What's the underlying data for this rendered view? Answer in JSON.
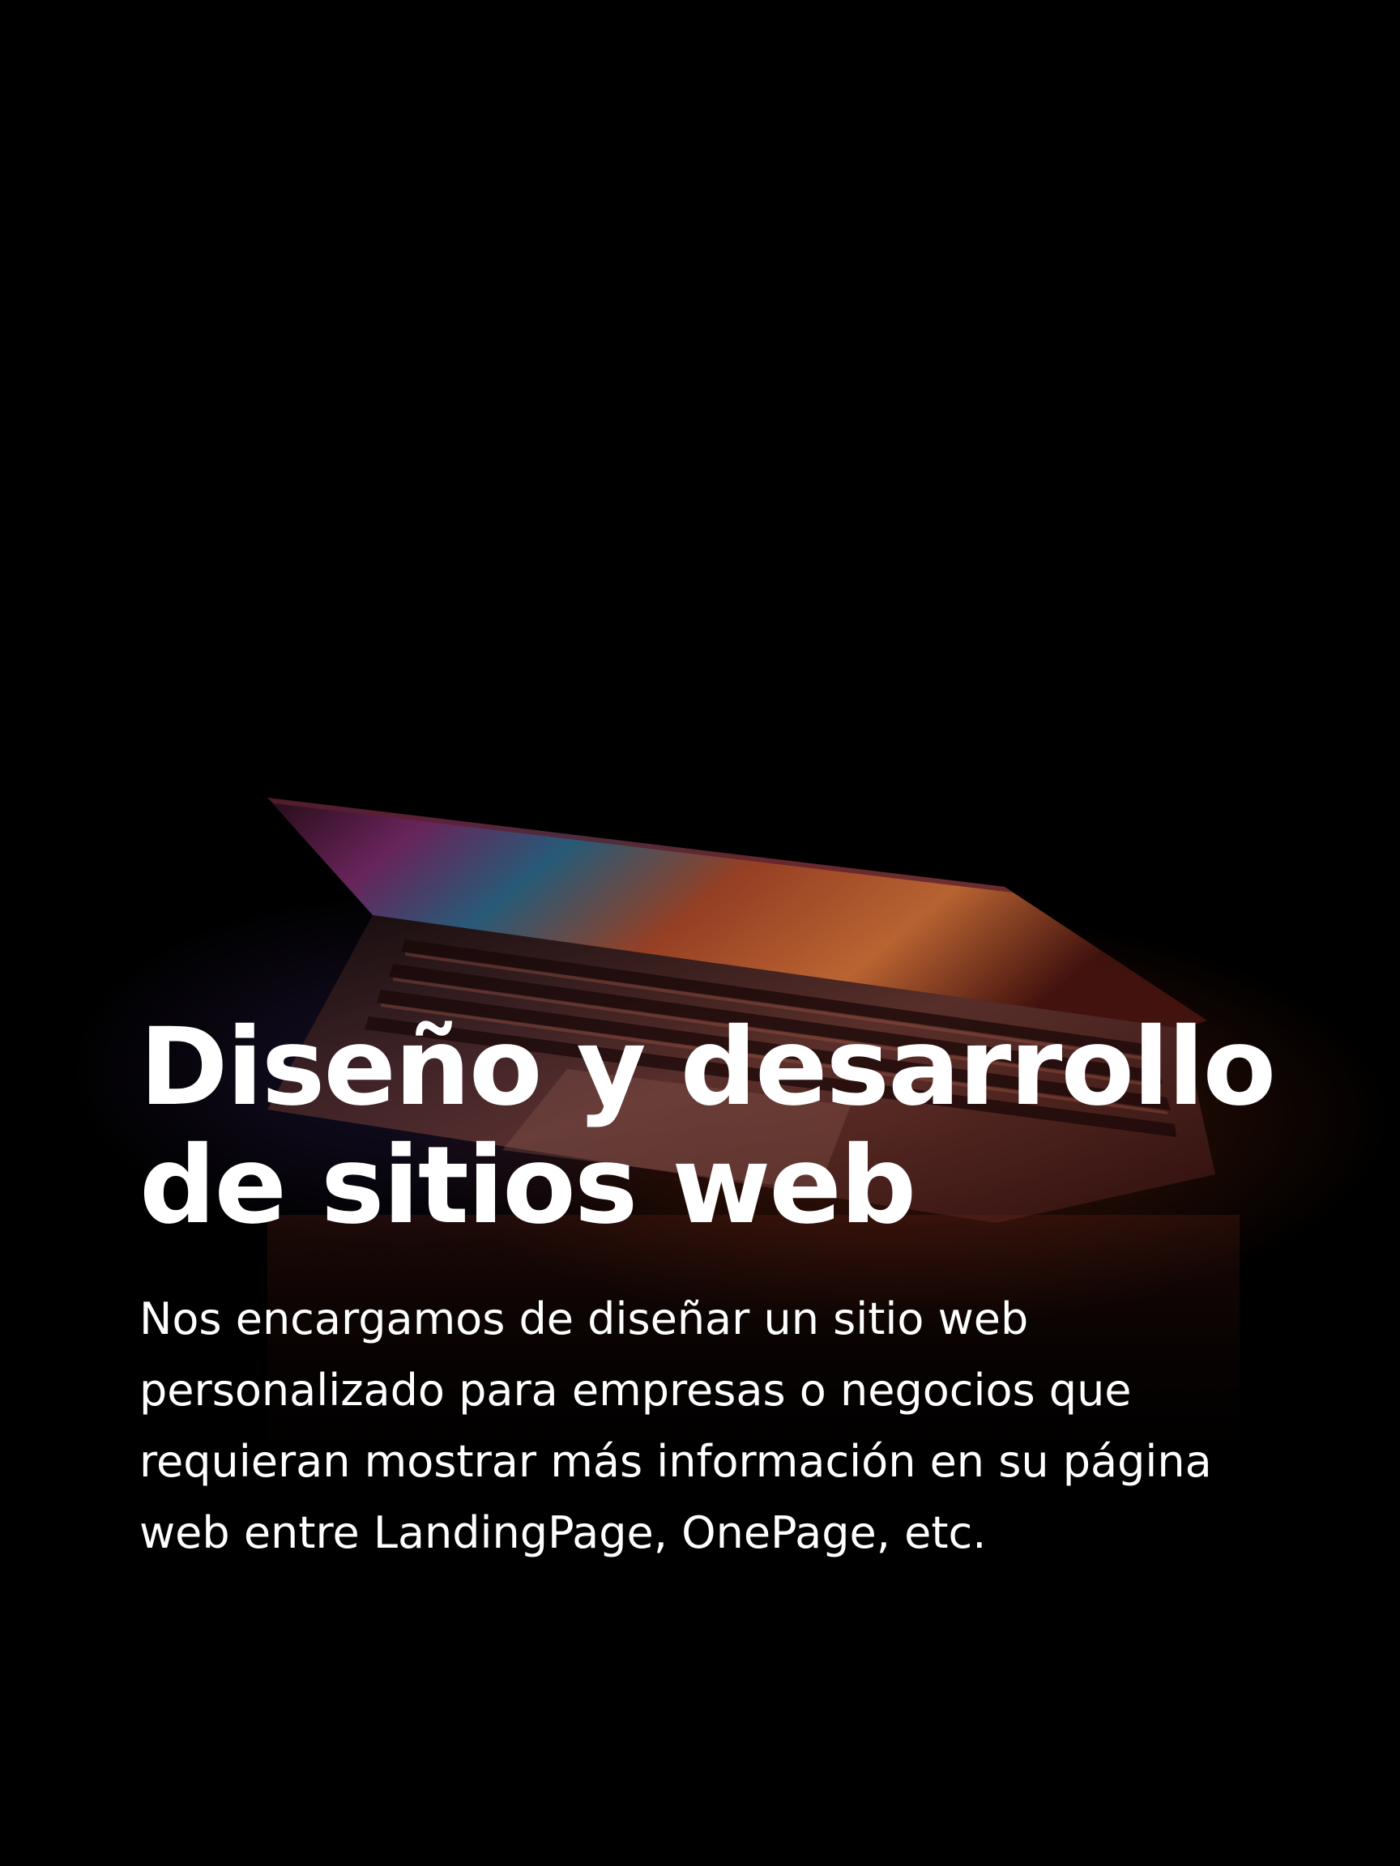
{
  "hero": {
    "title": "Diseño y desarrollo\nde sitios web",
    "description": "Nos encargamos de diseñar un sitio web personalizado para empresas o negocios que requieran mostrar más información en su página web entre  LandingPage, OnePage, etc."
  },
  "background": {
    "image": "laptop-photo",
    "color": "#000000"
  }
}
